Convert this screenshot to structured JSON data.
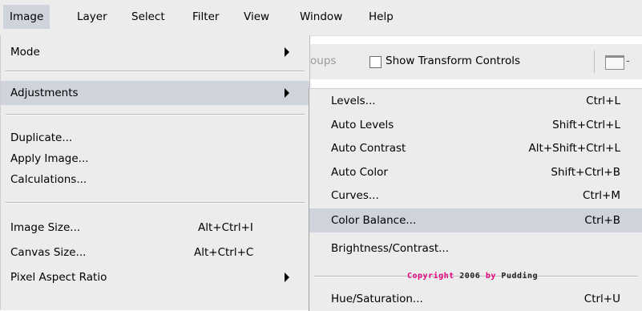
{
  "menubar": {
    "items": [
      {
        "label": "Image",
        "active": true
      },
      {
        "label": "Layer"
      },
      {
        "label": "Select"
      },
      {
        "label": "Filter"
      },
      {
        "label": "View"
      },
      {
        "label": "Window"
      },
      {
        "label": "Help"
      }
    ]
  },
  "options_bar": {
    "faded_text": "oups",
    "show_transform_label": "Show Transform Controls",
    "show_transform_checked": false,
    "trailing_dash": "-"
  },
  "image_menu": {
    "mode": {
      "label": "Mode"
    },
    "adjustments": {
      "label": "Adjustments"
    },
    "duplicate": {
      "label": "Duplicate..."
    },
    "apply_image": {
      "label": "Apply Image..."
    },
    "calculations": {
      "label": "Calculations..."
    },
    "image_size": {
      "label": "Image Size...",
      "shortcut": "Alt+Ctrl+I"
    },
    "canvas_size": {
      "label": "Canvas Size...",
      "shortcut": "Alt+Ctrl+C"
    },
    "pixel_aspect": {
      "label": "Pixel Aspect Ratio"
    }
  },
  "adjustments_menu": {
    "levels": {
      "label": "Levels...",
      "shortcut": "Ctrl+L"
    },
    "auto_levels": {
      "label": "Auto Levels",
      "shortcut": "Shift+Ctrl+L"
    },
    "auto_contrast": {
      "label": "Auto Contrast",
      "shortcut": "Alt+Shift+Ctrl+L"
    },
    "auto_color": {
      "label": "Auto Color",
      "shortcut": "Shift+Ctrl+B"
    },
    "curves": {
      "label": "Curves...",
      "shortcut": "Ctrl+M"
    },
    "color_balance": {
      "label": "Color Balance...",
      "shortcut": "Ctrl+B"
    },
    "brightness_contrast": {
      "label": "Brightness/Contrast..."
    },
    "hue_saturation": {
      "label": "Hue/Saturation...",
      "shortcut": "Ctrl+U"
    }
  },
  "watermark": {
    "copyright": "Copyright",
    "year": "2006",
    "by": "by",
    "name": "Pudding"
  },
  "colors": {
    "menu_bg": "#ececec",
    "highlight": "#cfd3db",
    "watermark_accent": "#e6007a"
  }
}
